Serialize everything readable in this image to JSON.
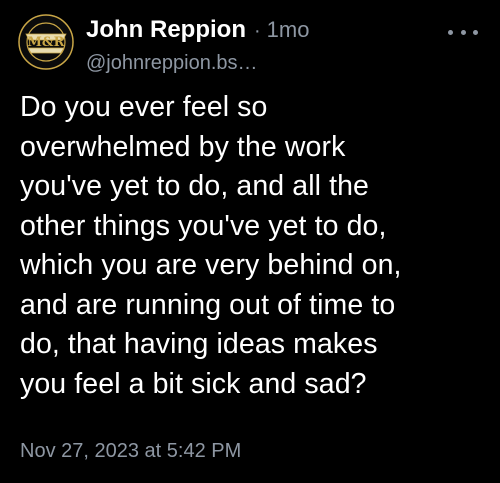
{
  "post": {
    "author": {
      "display_name": "John Reppion",
      "handle": "@johnreppion.bs…",
      "avatar_logo_text": "M&R",
      "avatar_banner_top": "EST",
      "avatar_banner_bottom": "MMX"
    },
    "separator": "·",
    "age": "1mo",
    "more_icon": "more-horizontal-icon",
    "text": "Do you ever feel so\noverwhelmed by the work\nyou've yet to do, and all the\nother things you've yet to do,\nwhich you are very behind on,\nand are running out of time to\ndo, that having ideas makes\nyou feel a bit sick and sad?",
    "timestamp": "Nov 27, 2023 at 5:42 PM"
  },
  "colors": {
    "background": "#000000",
    "text": "#ffffff",
    "muted": "#8e97a3",
    "avatar_gold": "#c9a646"
  }
}
